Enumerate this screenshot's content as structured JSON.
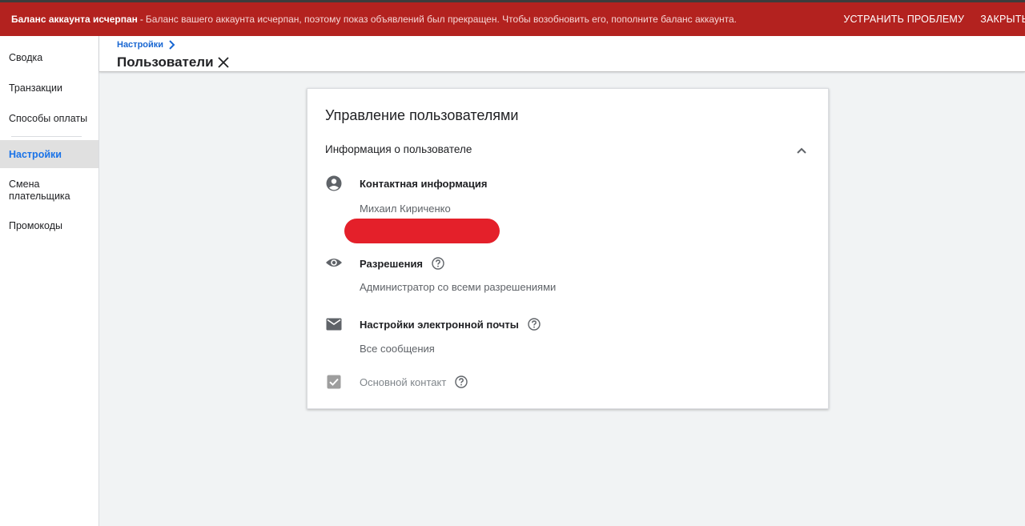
{
  "banner": {
    "title": "Баланс аккаунта исчерпан",
    "separator": "-",
    "message": "Баланс вашего аккаунта исчерпан, поэтому показ объявлений был прекращен. Чтобы возобновить его, пополните баланс аккаунта.",
    "fix_label": "УСТРАНИТЬ ПРОБЛЕМУ",
    "close_label": "ЗАКРЫТЬ",
    "color": "#b3221f"
  },
  "sidebar": {
    "items": [
      {
        "label": "Сводка"
      },
      {
        "label": "Транзакции"
      },
      {
        "label": "Способы оплаты"
      },
      {
        "label": "Настройки",
        "active": true
      },
      {
        "label": "Смена плательщика"
      },
      {
        "label": "Промокоды"
      }
    ]
  },
  "header": {
    "breadcrumb": "Настройки",
    "title": "Пользователи"
  },
  "card": {
    "title": "Управление пользователями",
    "section_title": "Информация о пользователе",
    "contact": {
      "icon": "account-circle-icon",
      "label": "Контактная информация",
      "name": "Михаил Кириченко"
    },
    "permissions": {
      "icon": "eye-icon",
      "label": "Разрешения",
      "value": "Администратор со всеми разрешениями"
    },
    "email_settings": {
      "icon": "mail-icon",
      "label": "Настройки электронной почты",
      "value": "Все сообщения"
    },
    "primary_contact": {
      "icon": "checkbox-checked-icon",
      "label": "Основной контакт",
      "checked": true
    }
  },
  "colors": {
    "accent": "#1a73e8",
    "redaction": "#e4202a"
  }
}
